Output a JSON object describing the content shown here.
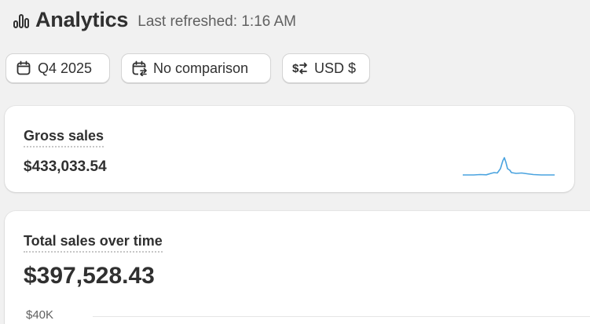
{
  "header": {
    "title": "Analytics",
    "last_refreshed": "Last refreshed: 1:16 AM",
    "icon": "bar-chart-icon"
  },
  "filters": {
    "date_range": {
      "label": "Q4 2025",
      "icon": "calendar-icon"
    },
    "comparison": {
      "label": "No comparison",
      "icon": "calendar-compare-icon"
    },
    "currency": {
      "label": "USD $",
      "icon": "currency-exchange-icon"
    }
  },
  "cards": {
    "gross_sales": {
      "label": "Gross sales",
      "value": "$433,033.54",
      "sparkline_color": "#4aa3df"
    },
    "total_sales": {
      "label": "Total sales over time",
      "value": "$397,528.43",
      "y_axis_top_tick": "$40K"
    }
  }
}
